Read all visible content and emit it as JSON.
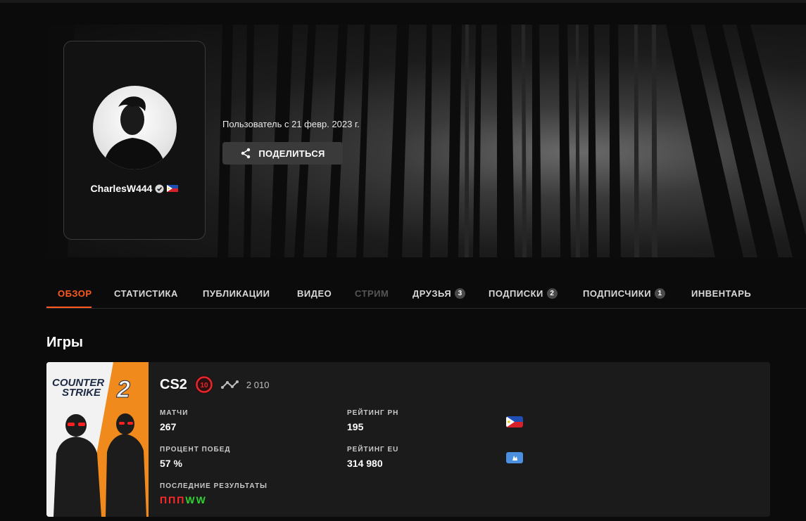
{
  "profile": {
    "username": "CharlesW444",
    "member_since": "Пользователь с 21 февр. 2023 г.",
    "share_label": "ПОДЕЛИТЬСЯ"
  },
  "tabs": [
    {
      "label": "ОБЗОР",
      "state": "active"
    },
    {
      "label": "СТАТИСТИКА",
      "state": "normal"
    },
    {
      "label": "ПУБЛИКАЦИИ",
      "state": "normal"
    },
    {
      "label": "ВИДЕО",
      "state": "normal"
    },
    {
      "label": "СТРИМ",
      "state": "disabled"
    },
    {
      "label": "ДРУЗЬЯ",
      "badge": "3"
    },
    {
      "label": "ПОДПИСКИ",
      "badge": "2"
    },
    {
      "label": "ПОДПИСЧИКИ",
      "badge": "1"
    },
    {
      "label": "ИНВЕНТАРЬ",
      "state": "normal"
    }
  ],
  "games_section": {
    "title": "Игры"
  },
  "game": {
    "cover_line1": "COUNTER",
    "cover_line2": "STRIKE",
    "cover_num": "2",
    "name": "CS2",
    "level": "10",
    "elo": "2 010",
    "matches_label": "МАТЧИ",
    "matches_value": "267",
    "winrate_label": "ПРОЦЕНТ ПОБЕД",
    "winrate_value": "57 %",
    "rating_ph_label": "РЕЙТИНГ PH",
    "rating_ph_value": "195",
    "rating_eu_label": "РЕЙТИНГ EU",
    "rating_eu_value": "314 980",
    "recent_label": "ПОСЛЕДНИЕ РЕЗУЛЬТАТЫ",
    "recent_results": [
      "Π",
      "Π",
      "Π",
      "W",
      "W"
    ]
  },
  "colors": {
    "accent": "#ff5a1f",
    "win": "#33d133",
    "loss": "#ff2a2a",
    "level_ring": "#e8262b",
    "cover_orange": "#f08a1c"
  }
}
